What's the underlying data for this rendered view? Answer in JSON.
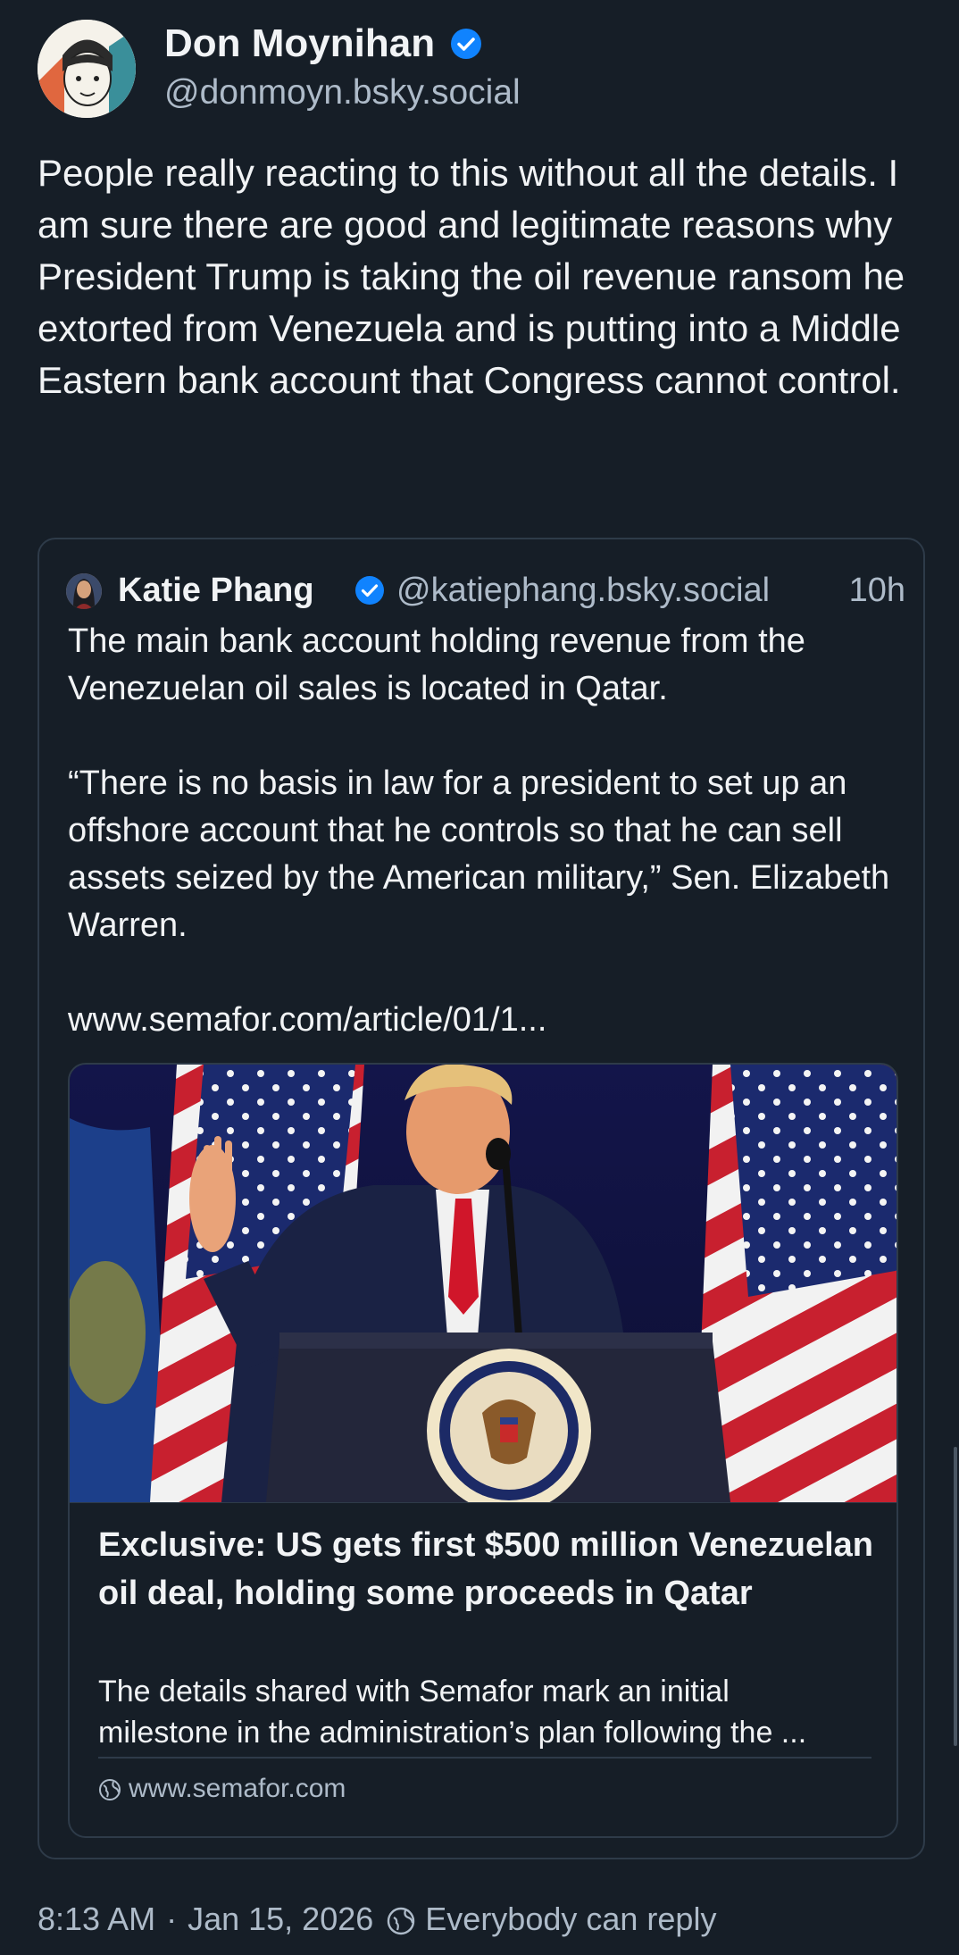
{
  "post": {
    "author": {
      "display_name": "Don Moynihan",
      "handle": "@donmoyn.bsky.social",
      "verified": true
    },
    "text": "People really reacting to this without all the details. I am sure there are good and legitimate reasons why President Trump is taking the oil revenue ransom he extorted from Venezuela and is putting into a Middle Eastern bank account that Congress cannot control.",
    "quote": {
      "author": {
        "display_name": "Katie Phang",
        "handle": "@katiephang.bsky.social",
        "verified": true
      },
      "time": "10h",
      "text": "The main bank account holding revenue from the Venezuelan oil sales is located in Qatar.\n\n“There is no basis in law for a president to set up an offshore account that he controls so that he can sell assets seized by the American military,” Sen. Elizabeth Warren.\n\nwww.semafor.com/article/01/1...",
      "link_card": {
        "title": "Exclusive: US gets first $500 million Venezuelan oil deal, holding some proceeds in Qatar",
        "description": "The details shared with Semafor mark an initial milestone in the administration’s plan following the ...",
        "domain": "www.semafor.com",
        "domain_icon": "globe-icon"
      }
    },
    "timestamp": "8:13 AM",
    "separator": "·",
    "date": "Jan 15, 2026",
    "reply_setting": "Everybody can reply",
    "reply_icon": "reply-restriction-icon"
  },
  "colors": {
    "background": "#161e27",
    "text": "#f1f3f5",
    "muted": "#aebbc9",
    "border": "#2e3b49",
    "verified": "#1083fe"
  }
}
